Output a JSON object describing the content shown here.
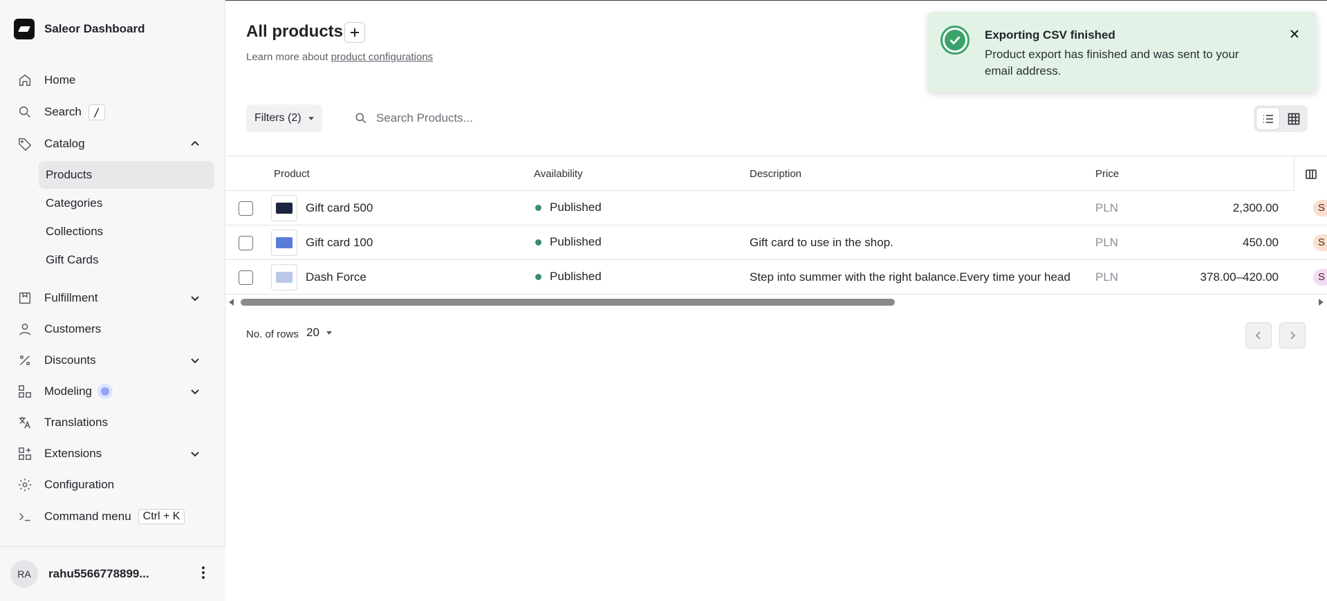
{
  "brand": {
    "name": "Saleor Dashboard"
  },
  "sidebar": {
    "home": "Home",
    "search": "Search",
    "search_kbd": "/",
    "catalog": "Catalog",
    "catalog_items": [
      "Products",
      "Categories",
      "Collections",
      "Gift Cards"
    ],
    "fulfillment": "Fulfillment",
    "customers": "Customers",
    "discounts": "Discounts",
    "modeling": "Modeling",
    "translations": "Translations",
    "extensions": "Extensions",
    "configuration": "Configuration",
    "command_menu": "Command menu",
    "command_kbd": "Ctrl + K"
  },
  "user": {
    "initials": "RA",
    "name": "rahu5566778899..."
  },
  "header": {
    "title": "All products",
    "learn_prefix": "Learn more about ",
    "learn_link": "product configurations"
  },
  "toolbar": {
    "filters_label": "Filters (2)",
    "search_placeholder": "Search Products..."
  },
  "table": {
    "columns": [
      "Product",
      "Availability",
      "Description",
      "Price"
    ],
    "rows": [
      {
        "name": "Gift card 500",
        "availability": "Published",
        "description": "",
        "currency": "PLN",
        "price": "2,300.00",
        "pill": "S",
        "pill_color": "#fbe0cf",
        "thumb_color": "#1c2440"
      },
      {
        "name": "Gift card 100",
        "availability": "Published",
        "description": "Gift card to use in the shop.",
        "currency": "PLN",
        "price": "450.00",
        "pill": "S",
        "pill_color": "#fbe0cf",
        "thumb_color": "#5a7bd8"
      },
      {
        "name": "Dash Force",
        "availability": "Published",
        "description": "Step into summer with the right balance.Every time your head",
        "currency": "PLN",
        "price": "378.00–420.00",
        "pill": "S",
        "pill_color": "#f3dcf3",
        "thumb_color": "#b9c8e8"
      }
    ]
  },
  "pagination": {
    "rows_label": "No. of rows",
    "rows_value": "20"
  },
  "toast": {
    "title": "Exporting CSV finished",
    "message": "Product export has finished and was sent to your email address."
  },
  "colors": {
    "toast_bg": "#e3f2e7",
    "success": "#3aa36a",
    "published_dot": "#3a8a72"
  }
}
